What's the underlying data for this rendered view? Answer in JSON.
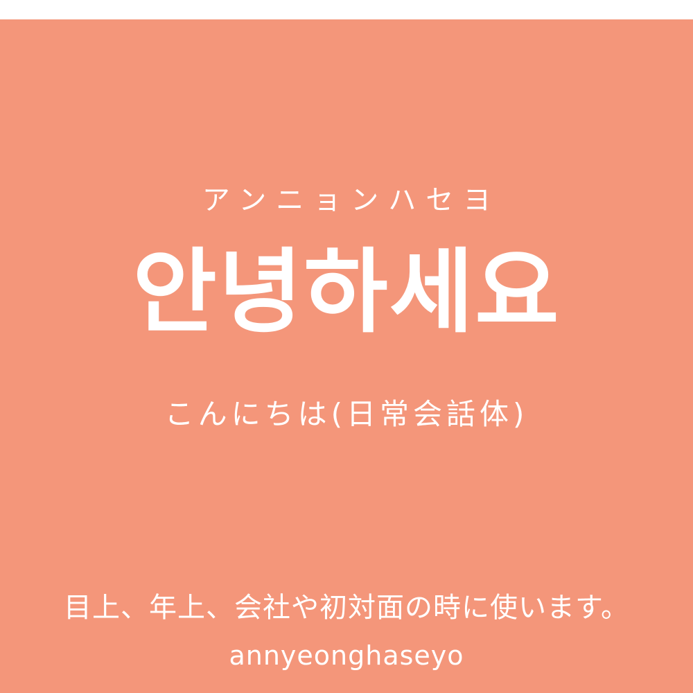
{
  "card": {
    "background_color": "#f4967a",
    "text_color": "#ffffff",
    "reading_katakana": "アンニョンハセヨ",
    "phrase_hangul": "안녕하세요",
    "meaning_japanese": "こんにちは(日常会話体)",
    "usage_note": "目上、年上、会社や初対面の時に使います。",
    "romanization": "annyeonghaseyo"
  }
}
